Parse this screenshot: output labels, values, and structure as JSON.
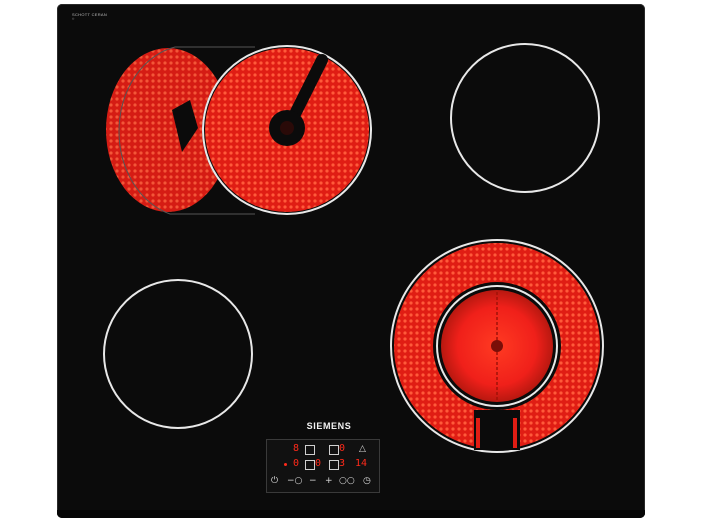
{
  "brand": {
    "name": "SIEMENS",
    "glass_mark": "SCHOTT CERAN",
    "glass_sub": "®"
  },
  "colors": {
    "glass": "#0b0b0b",
    "zone_outline": "#e8e8e8",
    "heat_red": "#ff2a1a",
    "heat_glow": "#d81a10",
    "display_red": "#ff2a1a"
  },
  "zones": [
    {
      "name": "rear-left-dual-zone",
      "state": "on"
    },
    {
      "name": "rear-right-zone",
      "state": "off"
    },
    {
      "name": "front-left-zone",
      "state": "off"
    },
    {
      "name": "front-right-dual-zone",
      "state": "on"
    }
  ],
  "control_panel": {
    "top_row": [
      "8",
      "0"
    ],
    "mid_row": [
      "0",
      "0",
      "3",
      "14"
    ],
    "icons": [
      "power-icon",
      "child-lock-icon",
      "minus-icon",
      "plus-icon",
      "timer-icon"
    ]
  }
}
